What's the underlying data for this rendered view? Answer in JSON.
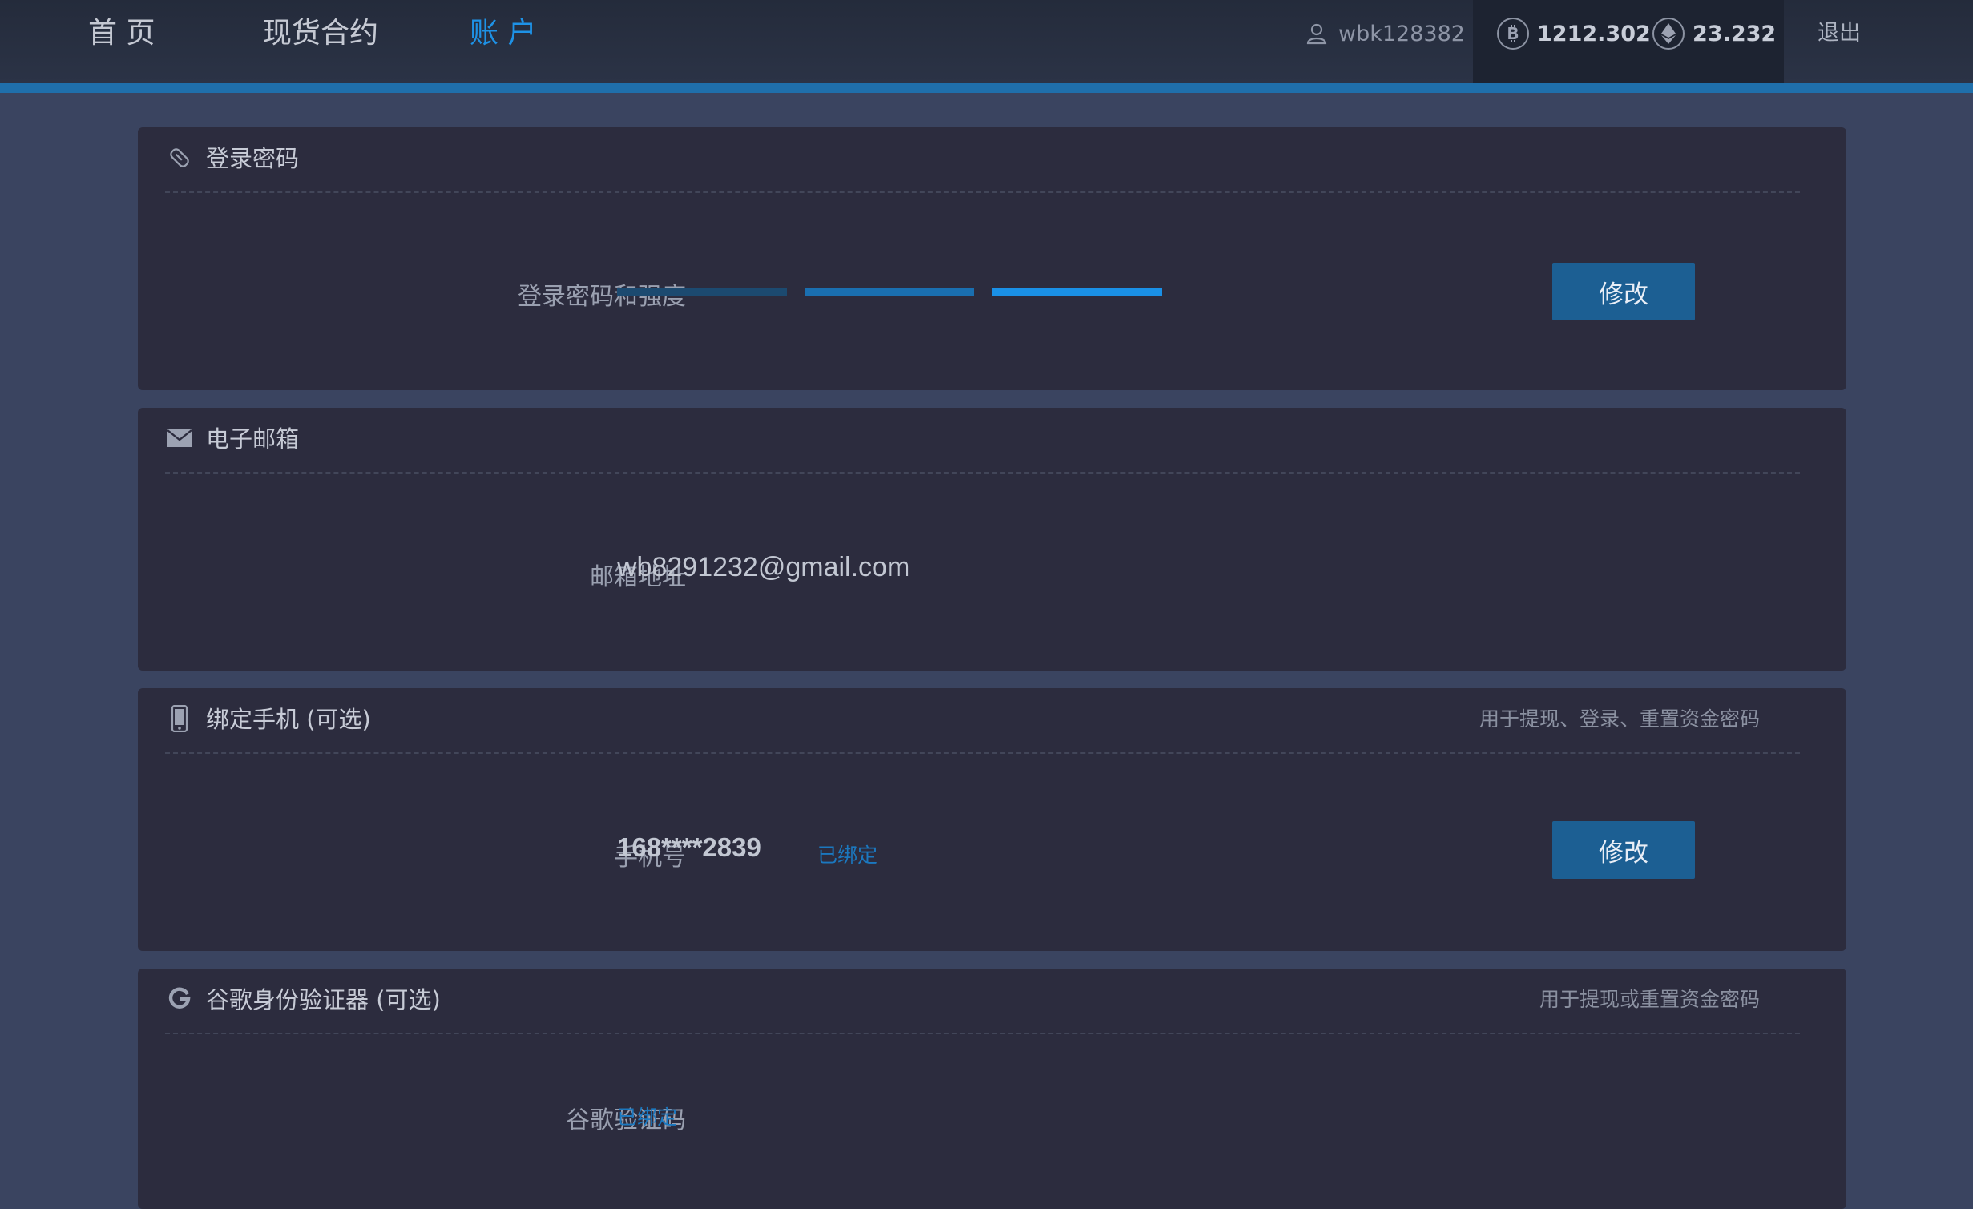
{
  "nav": {
    "home": "首 页",
    "spot": "现货合约",
    "account": "账 户"
  },
  "user": {
    "username": "wbk128382"
  },
  "balances": {
    "btc": "1212.302",
    "eth": "23.232"
  },
  "logout_label": "退出",
  "password_card": {
    "title": "登录密码",
    "label": "登录密码和强度",
    "strength_segments_filled": 3,
    "strength_segments_total": 3,
    "button": "修改"
  },
  "email_card": {
    "title": "电子邮箱",
    "label": "邮箱地址",
    "value": "wb8291232@gmail.com"
  },
  "phone_card": {
    "title": "绑定手机 (可选)",
    "note": "用于提现、登录、重置资金密码",
    "label": "手机号",
    "value": "168****2839",
    "status": "已绑定",
    "button": "修改"
  },
  "google_card": {
    "title": "谷歌身份验证器 (可选)",
    "note": "用于提现或重置资金密码",
    "label": "谷歌验证码",
    "status": "已绑定"
  },
  "colors": {
    "accent": "#1e92e6",
    "button": "#1c5f93",
    "strength": [
      "#1c4a70",
      "#1a6fb0",
      "#1a90e6"
    ]
  }
}
